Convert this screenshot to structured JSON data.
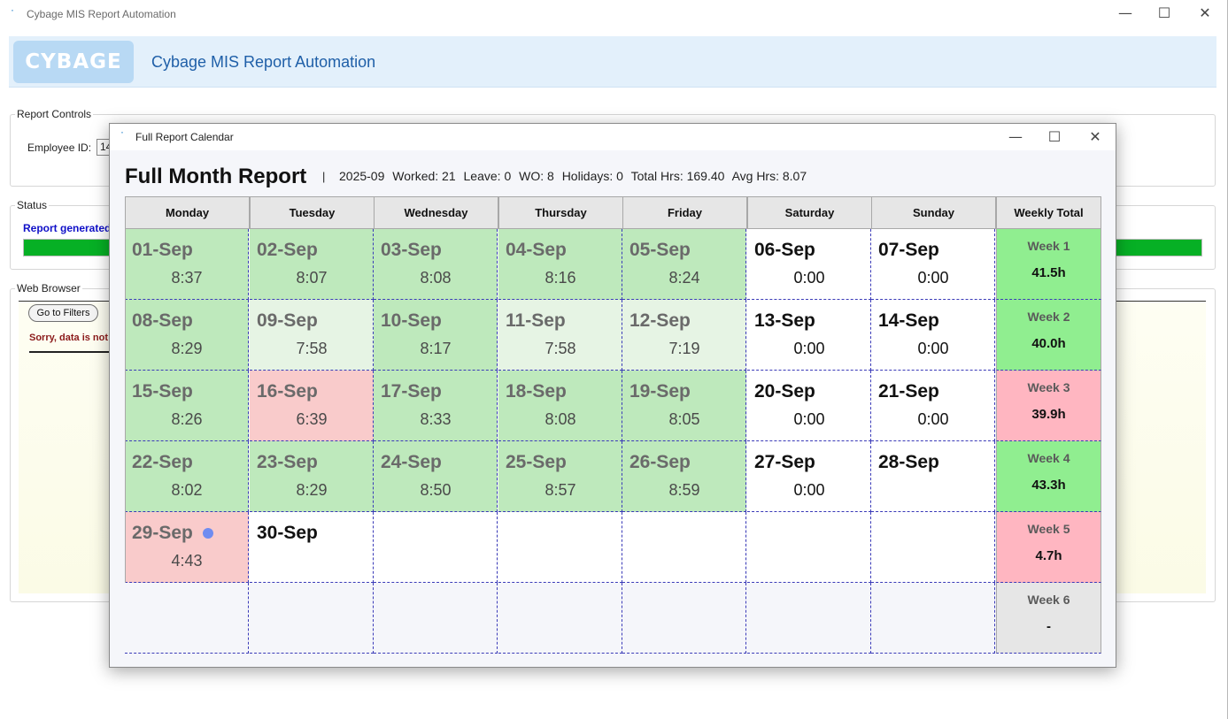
{
  "main_window": {
    "title": "Cybage MIS Report Automation",
    "minimize": "—",
    "maximize": "☐",
    "close": "✕"
  },
  "banner": {
    "logo_text": "CYBAGE",
    "title": "Cybage MIS Report Automation"
  },
  "report_controls": {
    "legend": "Report Controls",
    "employee_id_label": "Employee ID:",
    "employee_id_value": "14"
  },
  "status": {
    "legend": "Status",
    "message": "Report generated",
    "progress": 1.0
  },
  "web_browser": {
    "legend": "Web Browser",
    "go_to_filters": "Go to Filters",
    "message": "Sorry, data is not"
  },
  "calendar_window": {
    "title": "Full Report Calendar",
    "heading": "Full Month Report",
    "separator": "|",
    "month": "2025-09",
    "worked": "Worked: 21",
    "leave": "Leave: 0",
    "wo": "WO: 8",
    "holidays": "Holidays: 0",
    "total_hrs": "Total Hrs: 169.40",
    "avg_hrs": "Avg Hrs: 8.07",
    "columns": [
      "Monday",
      "Tuesday",
      "Wednesday",
      "Thursday",
      "Friday",
      "Saturday",
      "Sunday",
      "Weekly Total"
    ],
    "weeks": [
      {
        "days": [
          {
            "date": "01-Sep",
            "hours": "8:37",
            "kind": "worked"
          },
          {
            "date": "02-Sep",
            "hours": "8:07",
            "kind": "worked"
          },
          {
            "date": "03-Sep",
            "hours": "8:08",
            "kind": "worked"
          },
          {
            "date": "04-Sep",
            "hours": "8:16",
            "kind": "worked"
          },
          {
            "date": "05-Sep",
            "hours": "8:24",
            "kind": "worked"
          },
          {
            "date": "06-Sep",
            "hours": "0:00",
            "kind": "off"
          },
          {
            "date": "07-Sep",
            "hours": "0:00",
            "kind": "off"
          }
        ],
        "label": "Week 1",
        "total": "41.5h",
        "status": "good"
      },
      {
        "days": [
          {
            "date": "08-Sep",
            "hours": "8:29",
            "kind": "worked"
          },
          {
            "date": "09-Sep",
            "hours": "7:58",
            "kind": "light"
          },
          {
            "date": "10-Sep",
            "hours": "8:17",
            "kind": "worked"
          },
          {
            "date": "11-Sep",
            "hours": "7:58",
            "kind": "light"
          },
          {
            "date": "12-Sep",
            "hours": "7:19",
            "kind": "light"
          },
          {
            "date": "13-Sep",
            "hours": "0:00",
            "kind": "off"
          },
          {
            "date": "14-Sep",
            "hours": "0:00",
            "kind": "off"
          }
        ],
        "label": "Week 2",
        "total": "40.0h",
        "status": "good"
      },
      {
        "days": [
          {
            "date": "15-Sep",
            "hours": "8:26",
            "kind": "worked"
          },
          {
            "date": "16-Sep",
            "hours": "6:39",
            "kind": "short"
          },
          {
            "date": "17-Sep",
            "hours": "8:33",
            "kind": "worked"
          },
          {
            "date": "18-Sep",
            "hours": "8:08",
            "kind": "worked"
          },
          {
            "date": "19-Sep",
            "hours": "8:05",
            "kind": "worked"
          },
          {
            "date": "20-Sep",
            "hours": "0:00",
            "kind": "off"
          },
          {
            "date": "21-Sep",
            "hours": "0:00",
            "kind": "off"
          }
        ],
        "label": "Week 3",
        "total": "39.9h",
        "status": "bad"
      },
      {
        "days": [
          {
            "date": "22-Sep",
            "hours": "8:02",
            "kind": "worked"
          },
          {
            "date": "23-Sep",
            "hours": "8:29",
            "kind": "worked"
          },
          {
            "date": "24-Sep",
            "hours": "8:50",
            "kind": "worked"
          },
          {
            "date": "25-Sep",
            "hours": "8:57",
            "kind": "worked"
          },
          {
            "date": "26-Sep",
            "hours": "8:59",
            "kind": "worked"
          },
          {
            "date": "27-Sep",
            "hours": "0:00",
            "kind": "off"
          },
          {
            "date": "28-Sep",
            "hours": "",
            "kind": "off"
          }
        ],
        "label": "Week 4",
        "total": "43.3h",
        "status": "good"
      },
      {
        "days": [
          {
            "date": "29-Sep",
            "hours": "4:43",
            "kind": "short",
            "today": true
          },
          {
            "date": "30-Sep",
            "hours": "",
            "kind": "off"
          },
          {
            "date": "",
            "hours": "",
            "kind": "blank"
          },
          {
            "date": "",
            "hours": "",
            "kind": "blank"
          },
          {
            "date": "",
            "hours": "",
            "kind": "blank"
          },
          {
            "date": "",
            "hours": "",
            "kind": "blank"
          },
          {
            "date": "",
            "hours": "",
            "kind": "blank"
          }
        ],
        "label": "Week 5",
        "total": "4.7h",
        "status": "bad"
      },
      {
        "days": [
          {
            "date": "",
            "hours": "",
            "kind": "empty"
          },
          {
            "date": "",
            "hours": "",
            "kind": "empty"
          },
          {
            "date": "",
            "hours": "",
            "kind": "empty"
          },
          {
            "date": "",
            "hours": "",
            "kind": "empty"
          },
          {
            "date": "",
            "hours": "",
            "kind": "empty"
          },
          {
            "date": "",
            "hours": "",
            "kind": "empty"
          },
          {
            "date": "",
            "hours": "",
            "kind": "empty"
          }
        ],
        "label": "Week 6",
        "total": "-",
        "status": "none"
      }
    ]
  },
  "colors": {
    "worked": "#bee9bc",
    "light": "#e6f4e4",
    "short": "#f9cbcb",
    "week_good": "#90ee90",
    "week_bad": "#ffb6c1",
    "week_none": "#e6e6e6",
    "progress": "#06b025",
    "banner_title": "#1f5fa8"
  }
}
